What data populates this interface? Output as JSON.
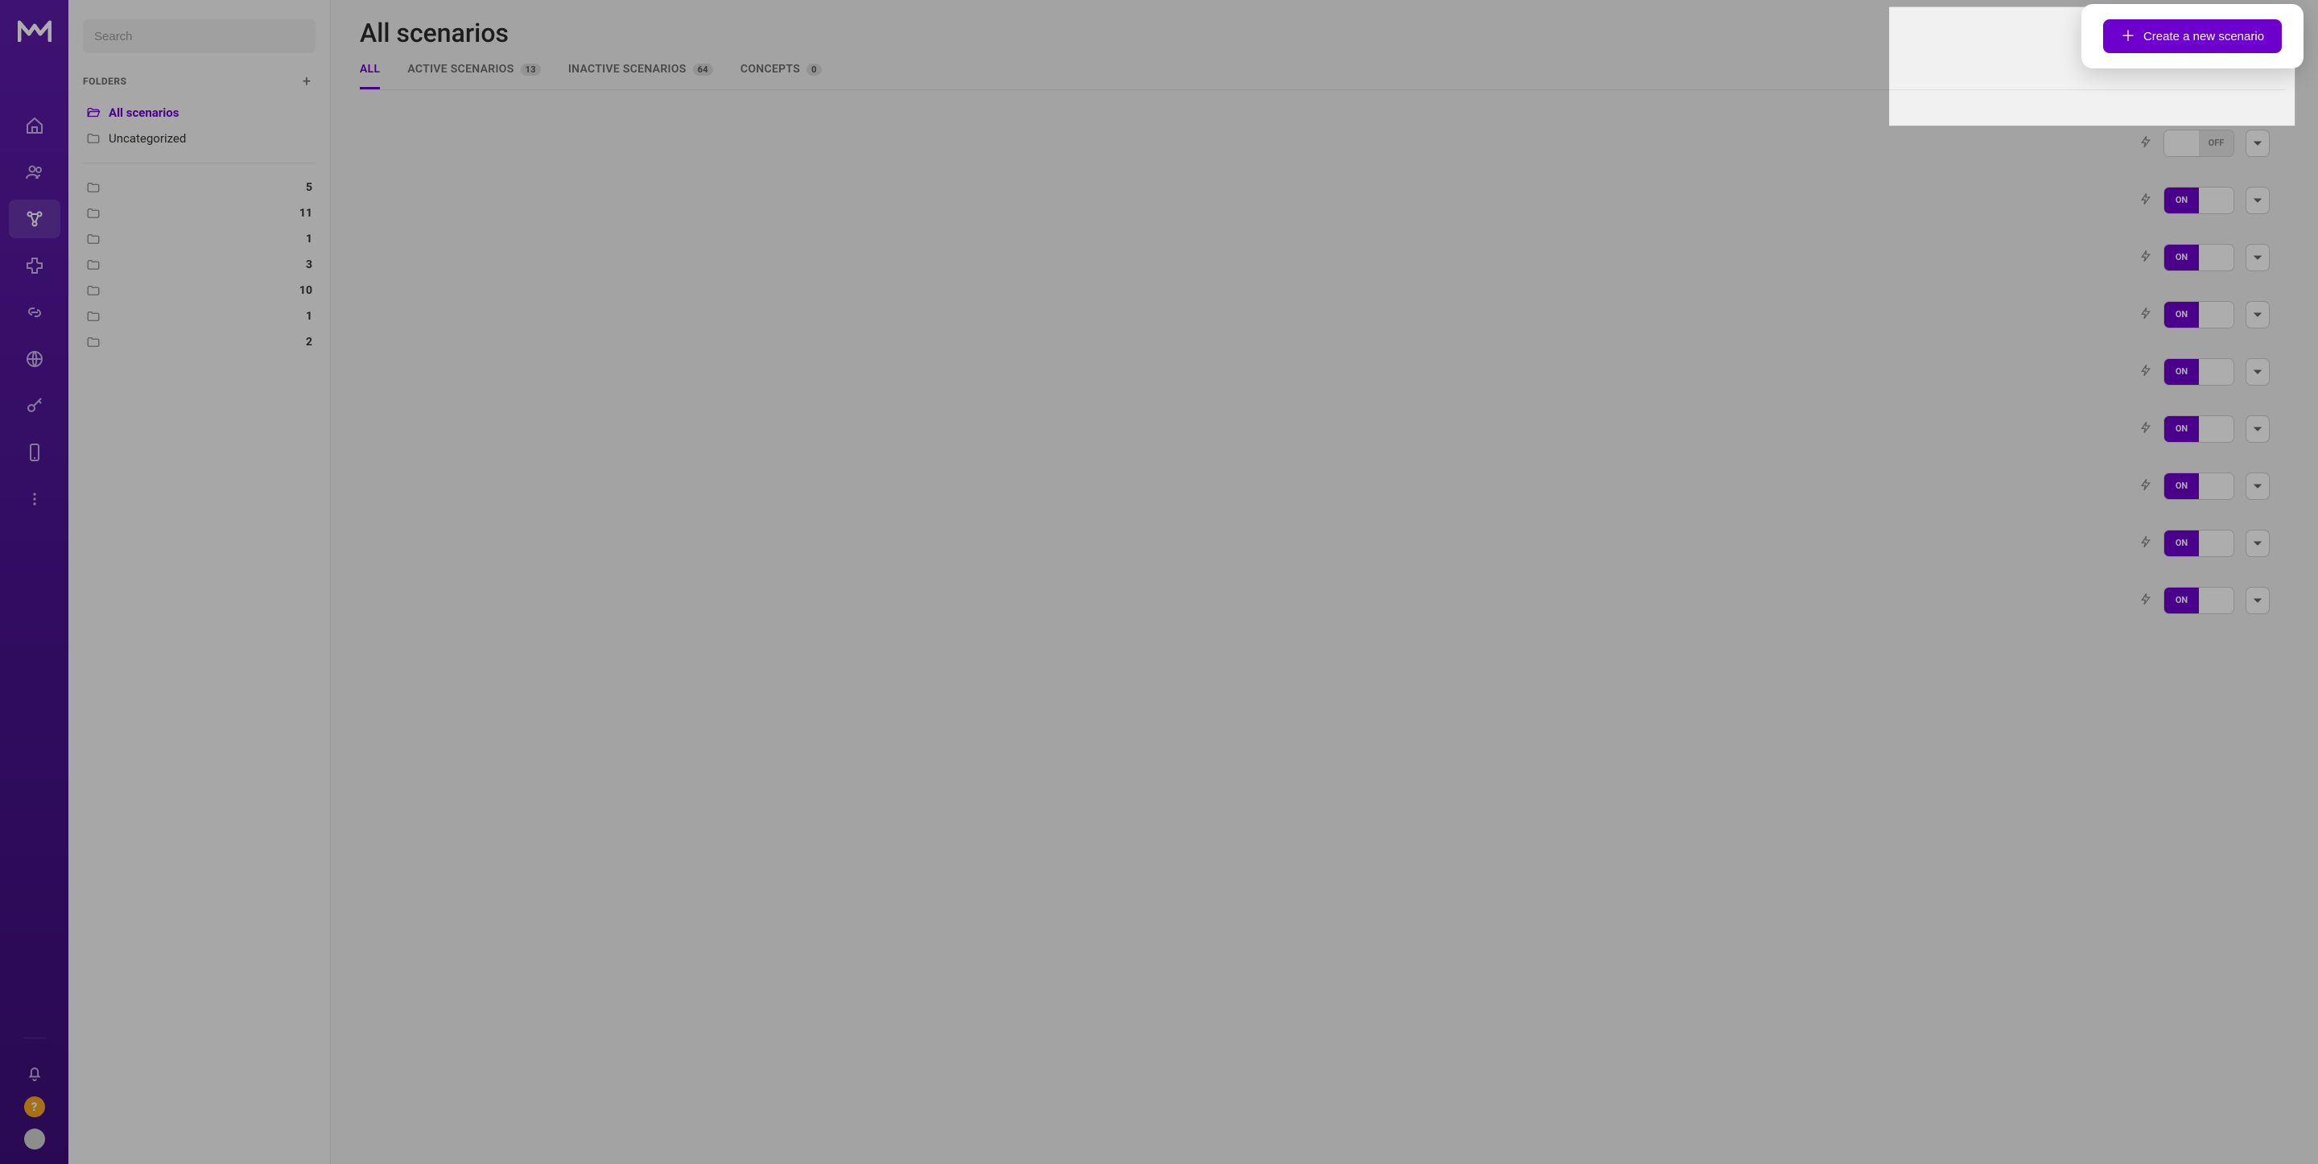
{
  "search": {
    "placeholder": "Search"
  },
  "sidebar": {
    "header_label": "FOLDERS",
    "named_folders": [
      {
        "label": "All scenarios",
        "selected": true,
        "icon": "folder-open"
      },
      {
        "label": "Uncategorized",
        "selected": false,
        "icon": "folder"
      }
    ],
    "count_folders": [
      {
        "count": "5"
      },
      {
        "count": "11"
      },
      {
        "count": "1"
      },
      {
        "count": "3"
      },
      {
        "count": "10"
      },
      {
        "count": "1"
      },
      {
        "count": "2"
      }
    ]
  },
  "header": {
    "title": "All scenarios",
    "create_label": "Create a new scenario"
  },
  "tabs": [
    {
      "label": "ALL",
      "badge": "",
      "active": true
    },
    {
      "label": "ACTIVE SCENARIOS",
      "badge": "13",
      "active": false
    },
    {
      "label": "INACTIVE SCENARIOS",
      "badge": "64",
      "active": false
    },
    {
      "label": "CONCEPTS",
      "badge": "0",
      "active": false
    }
  ],
  "rows": [
    {
      "state": "off",
      "label_off": "OFF"
    },
    {
      "state": "on",
      "label_on": "ON"
    },
    {
      "state": "on",
      "label_on": "ON"
    },
    {
      "state": "on",
      "label_on": "ON"
    },
    {
      "state": "on",
      "label_on": "ON"
    },
    {
      "state": "on",
      "label_on": "ON"
    },
    {
      "state": "on",
      "label_on": "ON"
    },
    {
      "state": "on",
      "label_on": "ON"
    },
    {
      "state": "on",
      "label_on": "ON"
    }
  ],
  "colors": {
    "brand": "#6d00cc",
    "help_badge": "#f5a623"
  }
}
